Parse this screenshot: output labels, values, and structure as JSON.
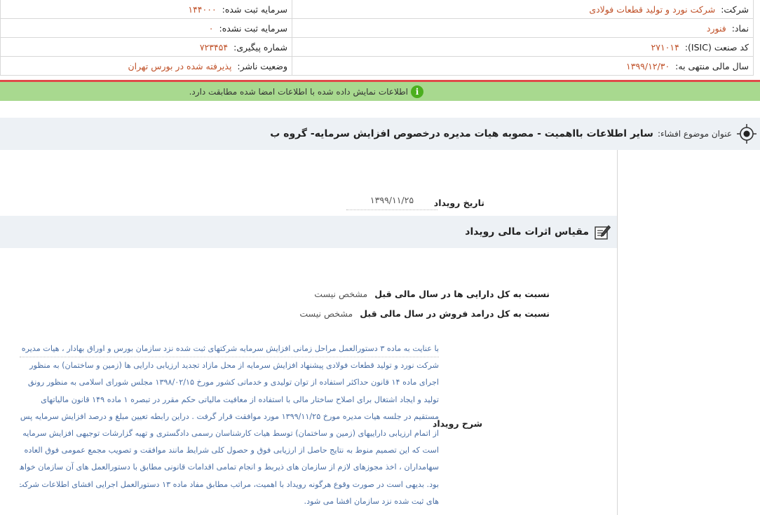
{
  "info": {
    "company_label": "شرکت:",
    "company_value": "شرکت نورد و تولید قطعات فولادی",
    "capital_reg_label": "سرمایه ثبت شده:",
    "capital_reg_value": "۱۴۴۰۰۰",
    "symbol_label": "نماد:",
    "symbol_value": "فنورد",
    "capital_unreg_label": "سرمایه ثبت نشده:",
    "capital_unreg_value": "۰",
    "isic_label": "کد صنعت (ISIC):",
    "isic_value": "۲۷۱۰۱۴",
    "tracking_label": "شماره پیگیری:",
    "tracking_value": "۷۲۳۴۵۴",
    "fiscal_label": "سال مالی منتهی به:",
    "fiscal_value": "۱۳۹۹/۱۲/۳۰",
    "status_label": "وضعیت ناشر:",
    "status_value": "پذیرفته شده در بورس تهران"
  },
  "notice": {
    "icon": "info-icon",
    "text": "اطلاعات نمایش داده شده با اطلاعات امضا شده مطابقت دارد."
  },
  "subject": {
    "label": "عنوان موضوع افشاء:",
    "value": "سایر اطلاعات بااهمیت - مصوبه هیات مدیره درخصوص افزایش سرمایه- گروه ب"
  },
  "event": {
    "date_label": "تاریخ رویداد",
    "date_value": "۱۳۹۹/۱۱/۲۵"
  },
  "impact": {
    "title": "مقیاس اثرات مالی رویداد",
    "assets_label": "نسبت به کل دارایی ها در سال مالی قبل",
    "assets_value": "مشخص نیست",
    "sales_label": "نسبت به کل درامد فروش در سال مالی قبل",
    "sales_value": "مشخص نیست"
  },
  "description": {
    "label": "شرح رویداد",
    "lines": [
      "با عنایت به ماده ۳ دستورالعمل مراحل زمانی افزایش سرمایه شرکتهای ثبت شده نزد سازمان بورس و اوراق بهادار ، هیات مدیره",
      "شرکت نورد و تولید قطعات فولادی پیشنهاد افزایش سرمایه از محل مازاد تجدید ارزیابی دارایی ها (زمین و ساختمان) به منظور",
      "اجرای ماده ۱۴ قانون حداکثر استفاده از توان تولیدی و خدماتی کشور مورخ ۱۳۹۸/۰۲/۱۵ مجلس شورای اسلامی به منظور رونق",
      "تولید و ایجاد اشتغال برای اصلاح ساختار مالی با استفاده از معافیت مالیاتی حکم مقرر در تبصره ۱ ماده ۱۴۹ قانون مالیاتهای",
      "مستقیم در جلسه هیات مدیره مورخ ۱۳۹۹/۱۱/۲۵ مورد موافقت قرار گرفت . دراین رابطه تعیین مبلغ و درصد افزایش سرمایه پس",
      "از اتمام ارزیابی داراییهای (زمین و ساختمان) توسط هیات کارشناسان رسمی دادگستری و تهیه گزارشات توجیهی افزایش سرمایه",
      "است که این تصمیم منوط به نتایج حاصل از ارزیابی فوق و حصول کلی شرایط مانند موافقت و تصویب مجمع عمومی فوق العاده",
      "سهامداران ، اخذ مجوزهای لازم از سازمان های ذیربط و انجام تمامی اقدامات قانونی مطابق با دستورالعمل های آن سازمان خواهد",
      "بود. بدیهی است در صورت وقوع هرگونه رویداد با اهمیت، مراتب مطابق مفاد ماده ۱۳ دستورالعمل اجرایی افشای اطلاعات شرکت",
      "های ثبت شده نزد سازمان افشا می شود."
    ]
  }
}
